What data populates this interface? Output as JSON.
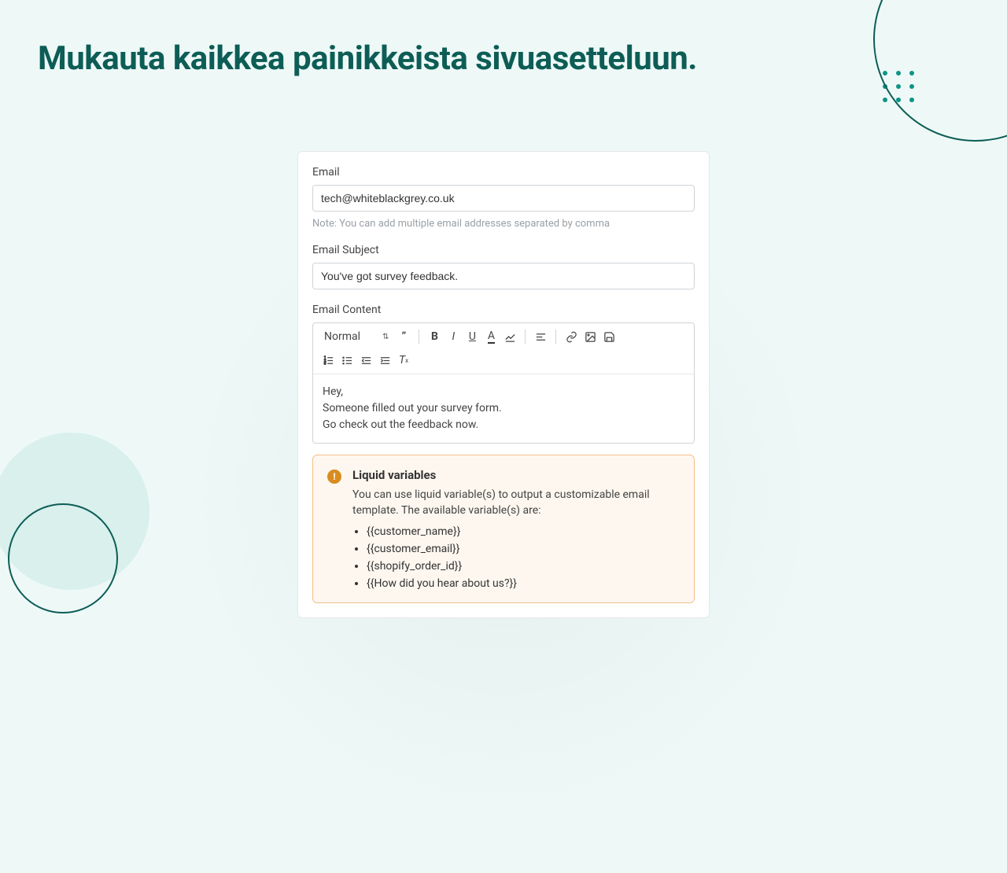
{
  "headline": "Mukauta kaikkea painikkeista sivuasetteluun.",
  "email": {
    "label": "Email",
    "value": "tech@whiteblackgrey.co.uk",
    "hint": "Note: You can add multiple email addresses separated by comma"
  },
  "subject": {
    "label": "Email Subject",
    "value": "You've got survey feedback."
  },
  "content": {
    "label": "Email Content",
    "font_select": "Normal",
    "body_line1": "Hey,",
    "body_line2": "Someone filled out your survey form.",
    "body_line3": "Go check out the feedback now."
  },
  "info": {
    "icon_glyph": "!",
    "title": "Liquid variables",
    "desc": "You can use liquid variable(s) to output a customizable email template. The available variable(s) are:",
    "vars": {
      "0": "{{customer_name}}",
      "1": "{{customer_email}}",
      "2": "{{shopify_order_id}}",
      "3": "{{How did you hear about us?}}"
    }
  }
}
